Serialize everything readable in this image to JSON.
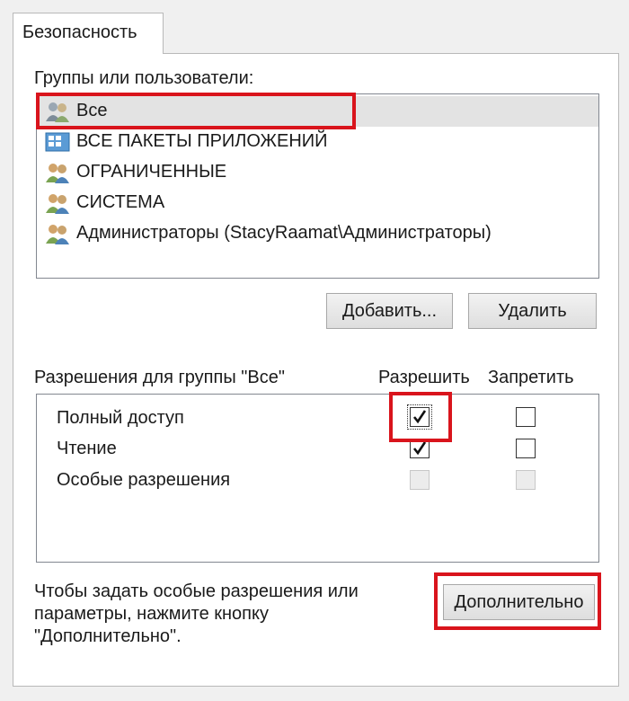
{
  "tab": {
    "label": "Безопасность"
  },
  "groups": {
    "label": "Группы или пользователи:",
    "items": [
      {
        "label": "Все",
        "icon": "users-group-icon"
      },
      {
        "label": "ВСЕ ПАКЕТЫ ПРИЛОЖЕНИЙ",
        "icon": "app-packages-icon"
      },
      {
        "label": "ОГРАНИЧЕННЫЕ",
        "icon": "users-group-icon"
      },
      {
        "label": "СИСТЕМА",
        "icon": "users-group-icon"
      },
      {
        "label": "Администраторы (StacyRaamat\\Администраторы)",
        "icon": "users-group-icon"
      }
    ]
  },
  "buttons": {
    "add": "Добавить...",
    "remove": "Удалить",
    "advanced": "Дополнительно"
  },
  "permissions": {
    "title": "Разрешения для группы \"Все\"",
    "allow_header": "Разрешить",
    "deny_header": "Запретить",
    "rows": [
      {
        "label": "Полный доступ",
        "allow": true,
        "deny": false
      },
      {
        "label": "Чтение",
        "allow": true,
        "deny": false
      },
      {
        "label": "Особые разрешения",
        "allow": false,
        "deny": false
      }
    ]
  },
  "note": {
    "line1": "Чтобы задать особые разрешения или",
    "line2": "параметры, нажмите кнопку",
    "line3": "\"Дополнительно\"."
  },
  "colors": {
    "highlight": "#d9141c",
    "selection": "#e3e3e3"
  }
}
